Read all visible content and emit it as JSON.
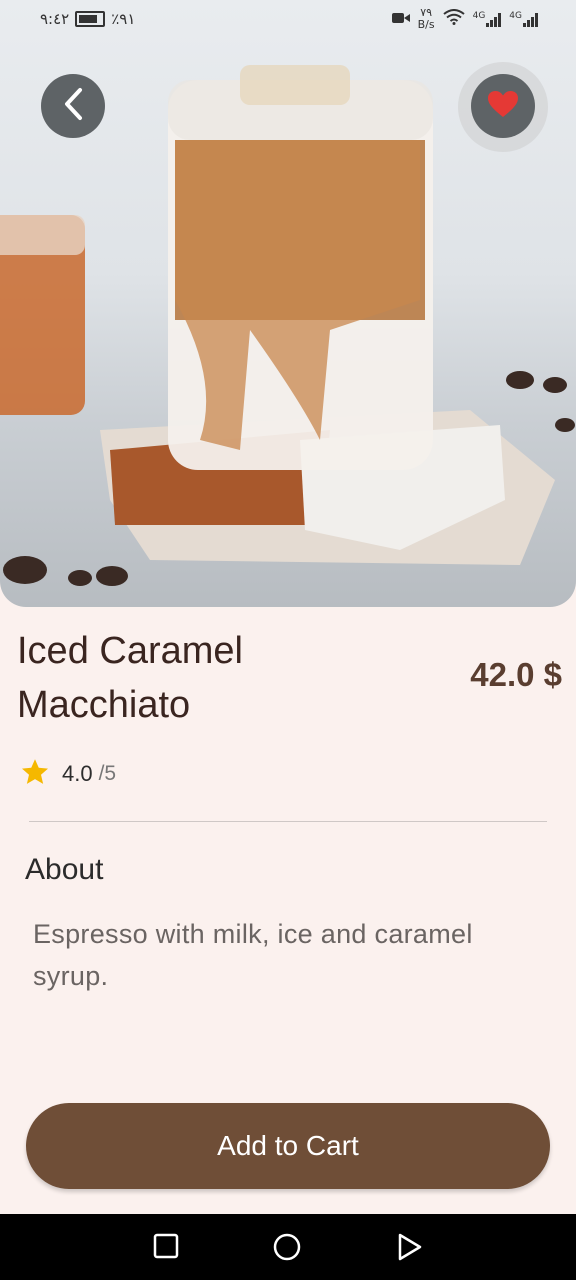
{
  "status_bar": {
    "time": "٩:٤٢",
    "battery": "٪٩١",
    "net_speed_value": "٧٩",
    "net_speed_unit": "B/s",
    "network_1": "4G",
    "network_2": "4G"
  },
  "product": {
    "name": "Iced Caramel Macchiato",
    "price": "42.0 $",
    "rating": "4.0",
    "rating_max": "/5",
    "about_heading": "About",
    "description": "Espresso with milk, ice and caramel syrup."
  },
  "actions": {
    "add_to_cart": "Add to Cart"
  },
  "colors": {
    "background": "#fbf1ee",
    "accent": "#6f4e37",
    "favorite": "#e53935",
    "star": "#f5b800"
  },
  "icons": {
    "back": "chevron-left-icon",
    "favorite": "heart-icon",
    "rating": "star-icon",
    "nav_recent": "square-icon",
    "nav_home": "circle-icon",
    "nav_back": "triangle-icon"
  }
}
